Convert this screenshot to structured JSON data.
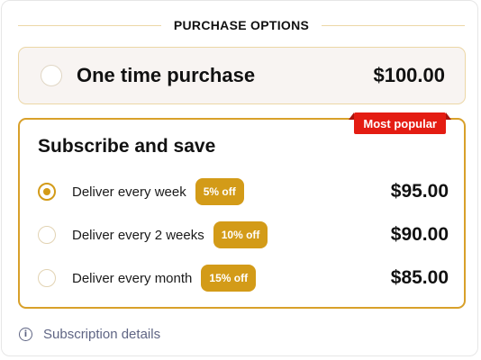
{
  "header": {
    "title": "PURCHASE OPTIONS"
  },
  "one_time": {
    "label": "One time purchase",
    "price": "$100.00",
    "selected": false
  },
  "subscribe": {
    "badge": "Most popular",
    "title": "Subscribe and save",
    "options": [
      {
        "label": "Deliver every week",
        "discount": "5% off",
        "price": "$95.00",
        "selected": true
      },
      {
        "label": "Deliver every 2 weeks",
        "discount": "10% off",
        "price": "$90.00",
        "selected": false
      },
      {
        "label": "Deliver every month",
        "discount": "15% off",
        "price": "$85.00",
        "selected": false
      }
    ]
  },
  "footer": {
    "details_label": "Subscription details",
    "icon": "info-icon"
  },
  "colors": {
    "accent": "#d39b18",
    "badge": "#e41c12",
    "muted": "#5f6584"
  }
}
